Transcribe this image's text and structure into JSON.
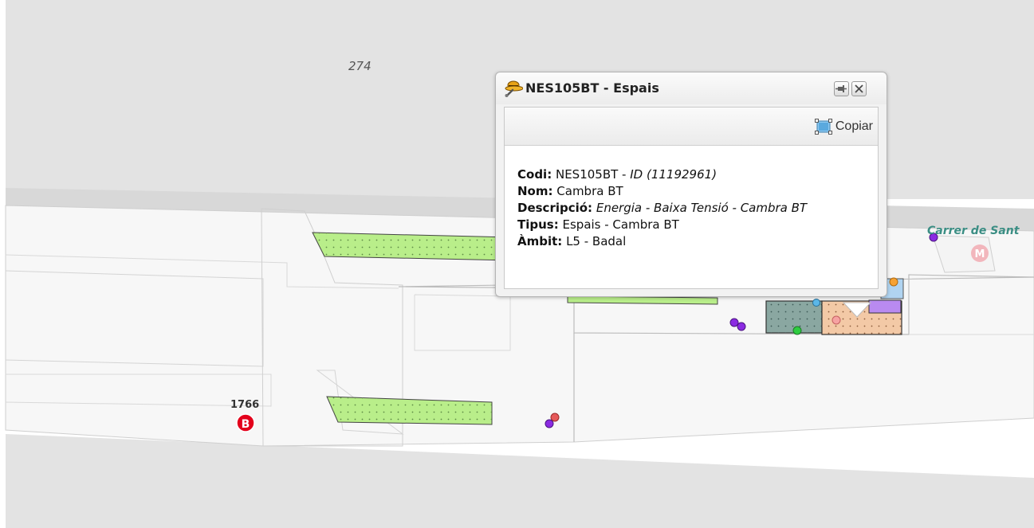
{
  "map": {
    "labels": {
      "block_number": "274",
      "street_name": "Carrer de Sant",
      "stop_number": "1766",
      "bus_marker": "B",
      "metro_marker": "M"
    },
    "colors": {
      "road": "#e3e3e3",
      "platform": "#f7f7f7",
      "block": "#ececec",
      "green_space": "#b9ee8a",
      "teal_space": "#8aa7a1",
      "orange_space": "#f3c9a6",
      "purple_space": "#b98af0",
      "bus_red": "#e3001b",
      "metro_pink": "#f2b6bc",
      "street_label": "#3b8e84"
    }
  },
  "popup": {
    "title": "NES105BT - Espais",
    "icon": "explorer-hat-icon",
    "pin_icon": "pin-icon",
    "close_icon": "close-icon",
    "copy_label": "Copiar",
    "copy_icon": "select-area-icon",
    "fields": {
      "codi_label": "Codi:",
      "codi_value": "NES105BT -",
      "codi_id": "ID (11192961)",
      "nom_label": "Nom:",
      "nom_value": "Cambra BT",
      "descripcio_label": "Descripció:",
      "descripcio_value": "Energia - Baixa Tensió - Cambra BT",
      "tipus_label": "Tipus:",
      "tipus_value": "Espais - Cambra BT",
      "ambit_label": "Àmbit:",
      "ambit_value": "L5 - Badal"
    }
  }
}
